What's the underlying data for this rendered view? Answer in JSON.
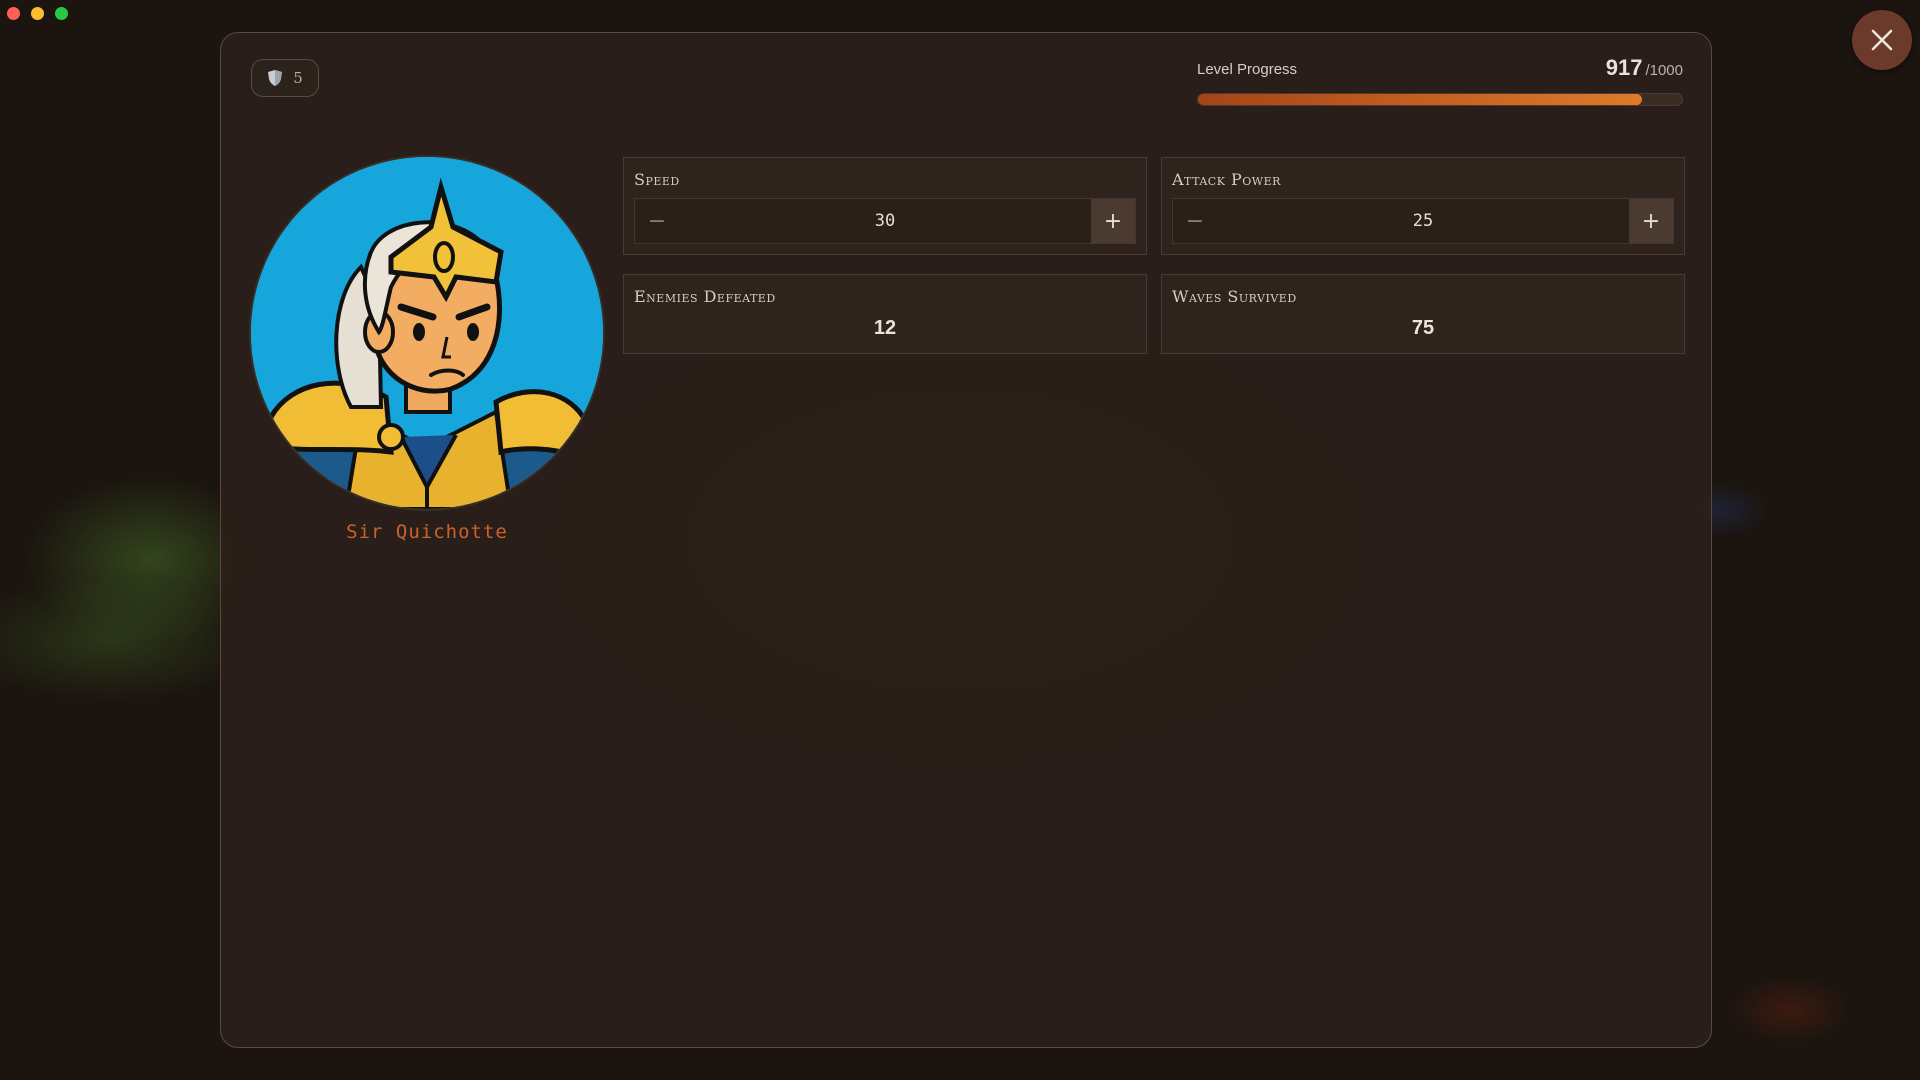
{
  "window": {
    "close_icon": "close-icon"
  },
  "badge": {
    "icon": "shield-icon",
    "count": "5"
  },
  "progress": {
    "label": "Level Progress",
    "current": "917",
    "max": "/1000",
    "fraction": 0.917,
    "color": "#e07a2a"
  },
  "hero": {
    "name": "Sir Quichotte",
    "portrait": "knight-portrait"
  },
  "stats": {
    "speed": {
      "title": "Speed",
      "value": "30"
    },
    "attack_power": {
      "title": "Attack Power",
      "value": "25"
    },
    "enemies_defeated": {
      "title": "Enemies Defeated",
      "value": "12"
    },
    "waves_survived": {
      "title": "Waves Survived",
      "value": "75"
    }
  },
  "colors": {
    "accent": "#c8632c",
    "panel": "#2a201a",
    "close_button": "#6b3a2a"
  }
}
